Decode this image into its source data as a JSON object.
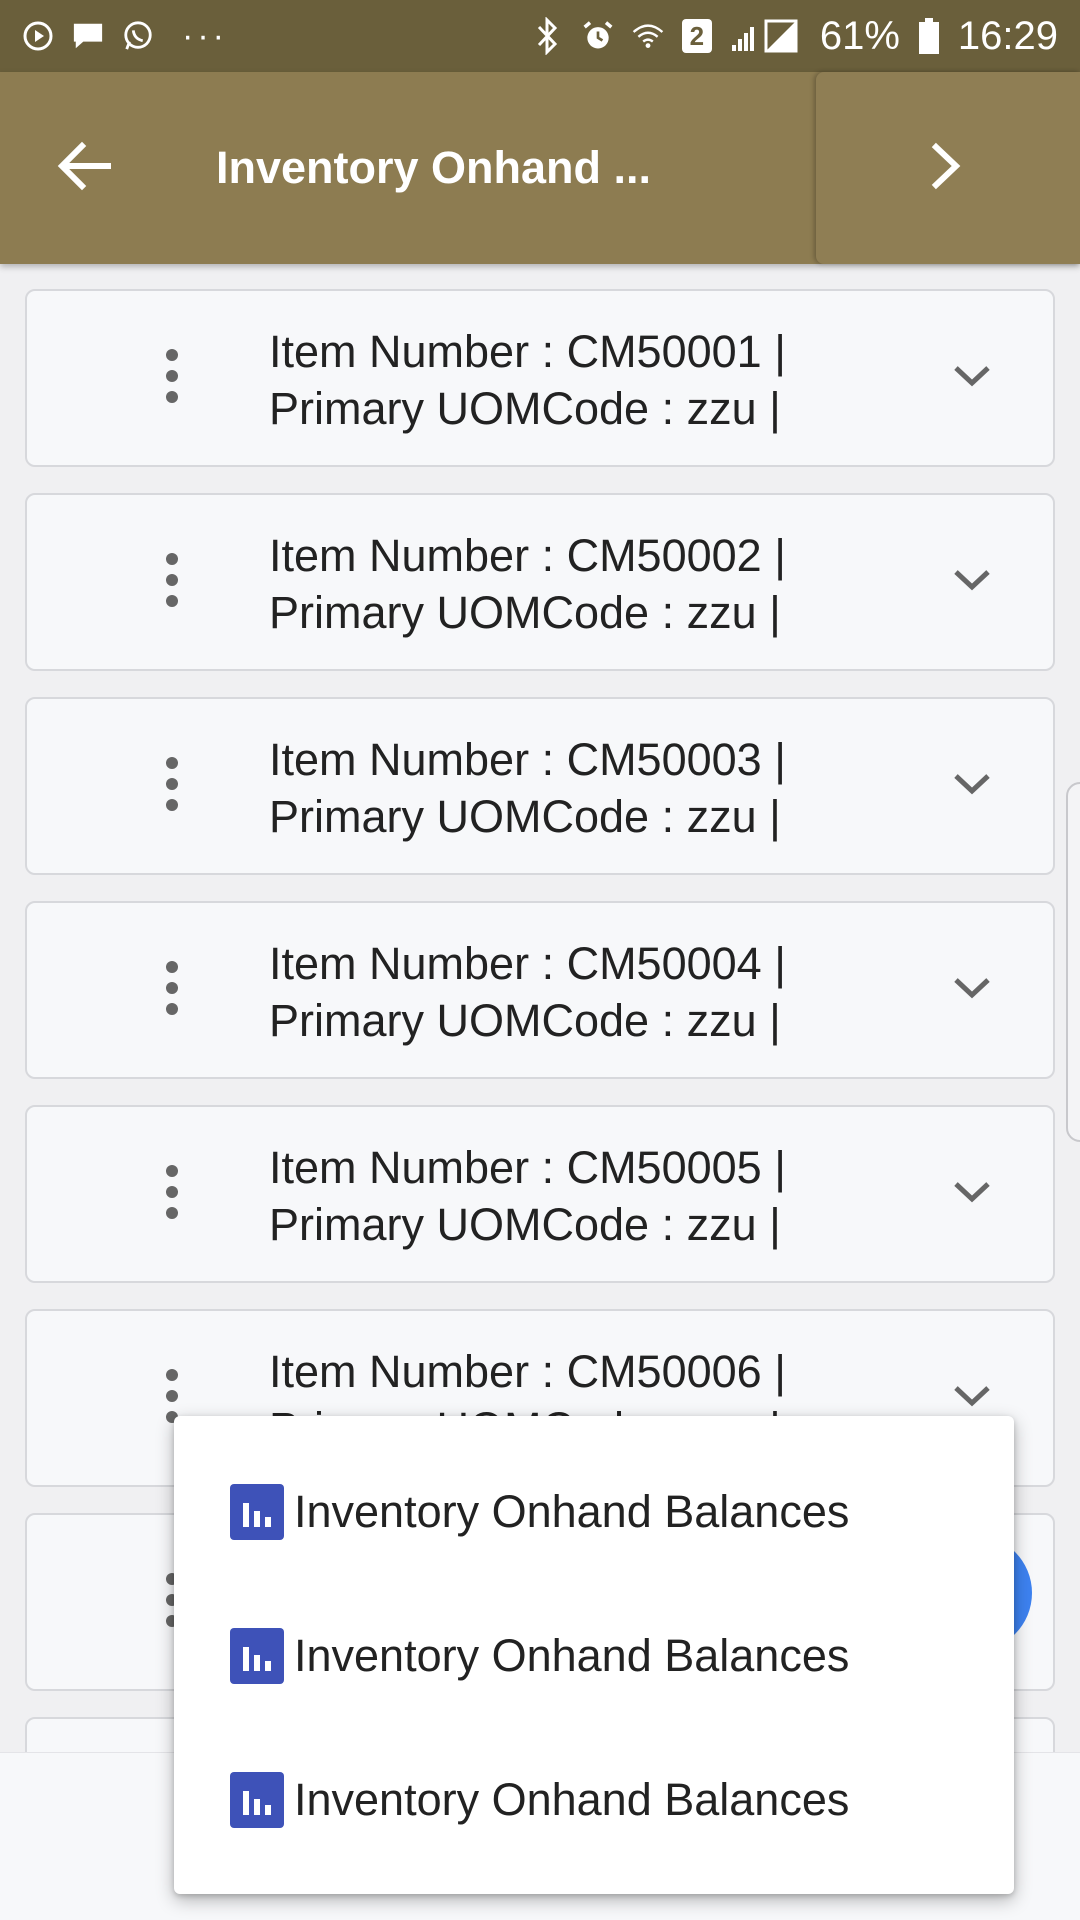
{
  "status_bar": {
    "battery_percent": "61%",
    "time": "16:29",
    "sim_badge": "2",
    "more": "···"
  },
  "app_bar": {
    "title": "Inventory Onhand ..."
  },
  "list": {
    "items": [
      {
        "line1": "Item Number : CM50001 |",
        "line2": "Primary UOMCode : zzu |"
      },
      {
        "line1": "Item Number : CM50002 |",
        "line2": "Primary UOMCode : zzu |"
      },
      {
        "line1": "Item Number : CM50003 |",
        "line2": "Primary UOMCode : zzu |"
      },
      {
        "line1": "Item Number : CM50004 |",
        "line2": "Primary UOMCode : zzu |"
      },
      {
        "line1": "Item Number : CM50005 |",
        "line2": "Primary UOMCode : zzu |"
      },
      {
        "line1": "Item Number : CM50006 |",
        "line2": "Primary UOMCode : zzu |"
      },
      {
        "line1": "",
        "line2": ""
      }
    ]
  },
  "menu": {
    "items": [
      {
        "label": "Inventory Onhand Balances",
        "icon": "bar-chart-icon"
      },
      {
        "label": "Inventory Onhand Balances",
        "icon": "bar-chart-icon"
      },
      {
        "label": "Inventory Onhand Balances",
        "icon": "bar-chart-icon"
      }
    ]
  },
  "colors": {
    "status_bar": "#6a5f3b",
    "app_bar": "#8d7c51",
    "menu_icon": "#3e52b8",
    "fab": "#3d82f0"
  }
}
